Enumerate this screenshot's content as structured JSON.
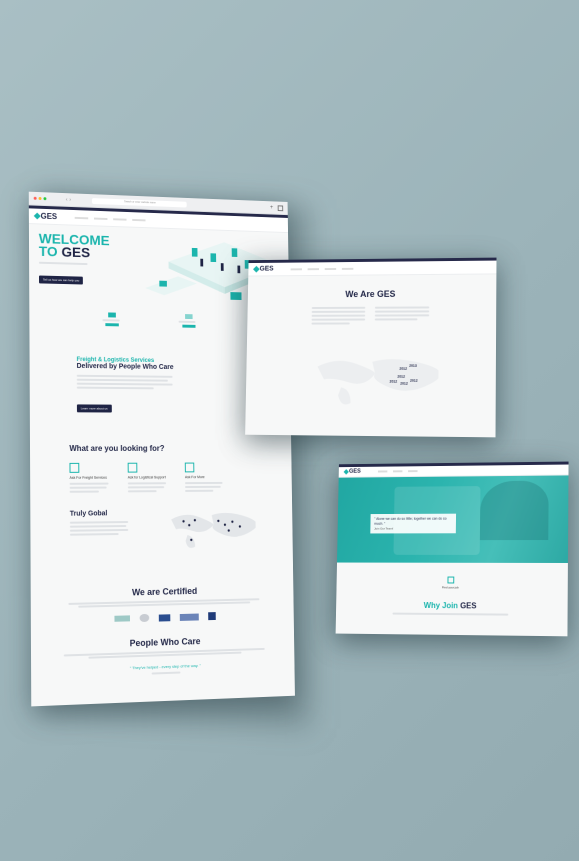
{
  "browser": {
    "address": "Search or enter website name"
  },
  "brand": {
    "name": "GES"
  },
  "home": {
    "welcome_line1": "WELCOME",
    "welcome_line2": "TO",
    "cta": "Tell us how we can help you",
    "freight_title_teal": "Freight & Logistics Services",
    "freight_title_navy": "Delivered by People Who Care",
    "learn_more": "Learn more about us",
    "looking_title": "What are you looking for?",
    "cards": [
      "Ask For Freight Services",
      "Ask for Logistical Support",
      "Ask For More"
    ],
    "global_title": "Truly Gobal",
    "certified_title": "We are Certified",
    "people_title": "People Who Care",
    "quote": "\" They've helped - every step of the way. \""
  },
  "about": {
    "title": "We Are GES",
    "years": [
      "2012",
      "2013",
      "2012",
      "2012",
      "2012",
      "2012"
    ]
  },
  "careers": {
    "quote": "\" Alone we can do so little; together we can do so much. \"",
    "subquote": "Join Our Team!",
    "link": "Find your job",
    "why_title": "Why Join"
  },
  "colors": {
    "teal": "#1bb5ad",
    "navy": "#1f2445",
    "background": "#9fb6bc"
  }
}
